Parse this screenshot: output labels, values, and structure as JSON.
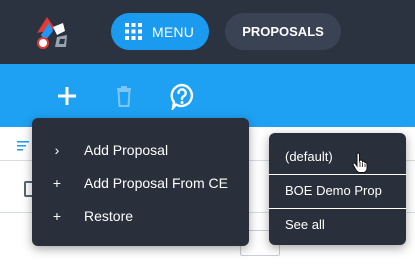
{
  "topbar": {
    "logo_icon": "app-logo",
    "menu": {
      "label": "MENU",
      "icon": "grid-icon"
    },
    "proposals": {
      "label": "PROPOSALS"
    }
  },
  "toolbar": {
    "actions": [
      {
        "icon": "plus-icon",
        "name": "add"
      },
      {
        "icon": "trash-icon",
        "name": "delete",
        "disabled": true
      },
      {
        "icon": "help-icon",
        "name": "help"
      }
    ]
  },
  "add_menu": {
    "items": [
      {
        "glyph": "›",
        "label": "Add Proposal"
      },
      {
        "glyph": "+",
        "label": "Add Proposal From CE"
      },
      {
        "glyph": "+",
        "label": "Restore"
      }
    ]
  },
  "proposal_menu": {
    "items": [
      {
        "label": "(default)"
      },
      {
        "label": "BOE Demo Prop"
      },
      {
        "label": "See all"
      }
    ]
  },
  "colors": {
    "topbar_bg": "#2b3340",
    "accent": "#1a9bf0",
    "toolbar_bg": "#1ea1f2",
    "menu_bg": "#2a303b"
  }
}
